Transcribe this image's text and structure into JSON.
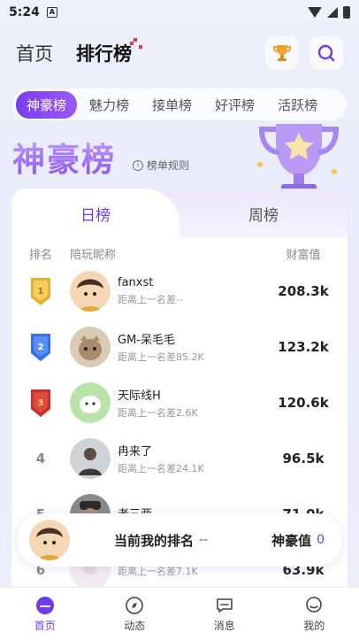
{
  "status": {
    "time": "5:24",
    "notif_icon": "A"
  },
  "top_nav": {
    "tabs": [
      "首页",
      "排行榜"
    ],
    "active": 1
  },
  "categories": [
    "神豪榜",
    "魅力榜",
    "接单榜",
    "好评榜",
    "活跃榜"
  ],
  "hero": {
    "title": "神豪榜",
    "rules_label": "榜单规则"
  },
  "periods": [
    "日榜",
    "周榜"
  ],
  "columns": {
    "rank": "排名",
    "name": "陪玩昵称",
    "wealth": "财富值"
  },
  "rows": [
    {
      "rank": "1",
      "name": "fanxst",
      "gap": "距离上一名差--",
      "wealth": "208.3k"
    },
    {
      "rank": "2",
      "name": "GM-呆毛毛",
      "gap": "距离上一名差85.2K",
      "wealth": "123.2k"
    },
    {
      "rank": "3",
      "name": "天际线H",
      "gap": "距离上一名差2.6K",
      "wealth": "120.6k"
    },
    {
      "rank": "4",
      "name": "冉来了",
      "gap": "距离上一名差24.1K",
      "wealth": "96.5k"
    },
    {
      "rank": "5",
      "name": "老三两",
      "gap": "",
      "wealth": "71.0k"
    },
    {
      "rank": "6",
      "name": "",
      "gap": "距离上一名差7.1K",
      "wealth": "63.9k"
    }
  ],
  "my_rank": {
    "label": "当前我的排名",
    "value": "--",
    "wealth_label": "神豪值",
    "wealth_value": "0"
  },
  "bottom_nav": [
    "首页",
    "动态",
    "消息",
    "我的"
  ],
  "colors": {
    "accent": "#6d3ce6",
    "gold": "#e5b134",
    "blue": "#3a6ef0",
    "red": "#c9302c"
  }
}
